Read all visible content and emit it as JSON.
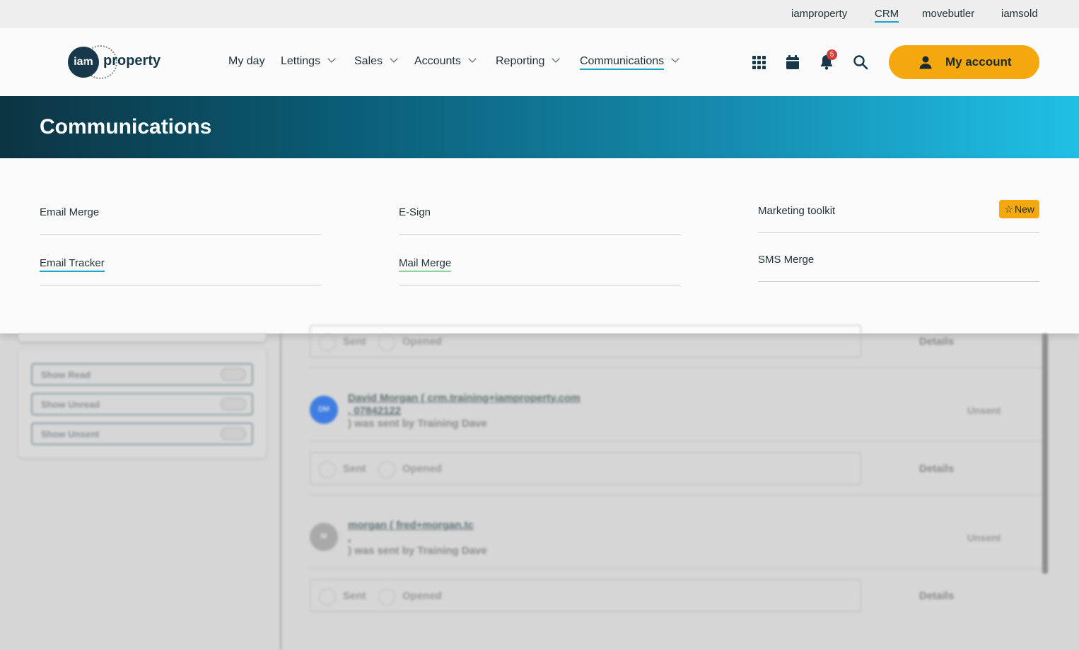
{
  "utility_links": [
    "iamproperty",
    "CRM",
    "movebutler",
    "iamsold"
  ],
  "logo": {
    "circle_text": "iam",
    "word": "property"
  },
  "nav": {
    "items": [
      "My day",
      "Lettings",
      "Sales",
      "Accounts",
      "Reporting",
      "Communications"
    ],
    "notification_count": "5",
    "account_label": "My account"
  },
  "banner": {
    "title": "Communications"
  },
  "menu": {
    "col1": [
      "Email Merge",
      "Email Tracker"
    ],
    "col2": [
      "E-Sign",
      "Mail Merge"
    ],
    "col3": [
      "Marketing toolkit",
      "SMS Merge"
    ],
    "new_badge": "New"
  },
  "background": {
    "filters": [
      "Show Read",
      "Show Unread",
      "Show Unsent"
    ],
    "status_labels": {
      "sent": "Sent",
      "opened": "Opened",
      "details": "Details"
    },
    "entries": [
      {
        "avatar": "DM",
        "title_line1": "David Morgan ( crm.training+iamproperty.com",
        "title_line2": ", 07842122",
        "sub": ") was sent by Training Dave",
        "status": "Unsent",
        "avatar_color": "#3f7ee0"
      },
      {
        "avatar": "M",
        "title_line1": "morgan ( fred+morgan.tc",
        "title_line2": ",",
        "sub": ") was sent by Training Dave",
        "status": "Unsent",
        "avatar_color": "#a9a9a9"
      }
    ]
  },
  "colors": {
    "accent": "#f5a80d",
    "underline": "#1aa4c8",
    "brand_dark": "#17384a"
  }
}
